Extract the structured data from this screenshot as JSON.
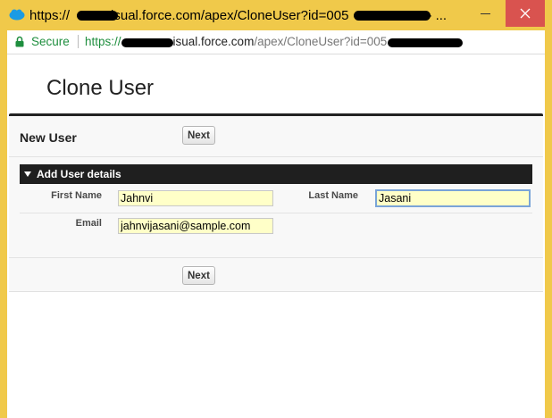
{
  "window": {
    "title": "https://",
    "title_tail": "isual.force.com/apex/CloneUser?id=005",
    "title_end": "- ..."
  },
  "address_bar": {
    "secure_label": "Secure",
    "url_scheme": "https://",
    "url_host": "isual.force.com",
    "url_path": "/apex/CloneUser?id=005"
  },
  "page": {
    "title": "Clone User"
  },
  "section": {
    "title": "New User",
    "next_label": "Next"
  },
  "user_details": {
    "header": "Add User details",
    "first_name_label": "First Name",
    "first_name_value": "Jahnvi",
    "last_name_label": "Last Name",
    "last_name_value": "Jasani",
    "email_label": "Email",
    "email_value": "jahnvijasani@sample.com"
  },
  "colors": {
    "title_bar": "#f0c94a",
    "secure_green": "#1e8e3e",
    "input_fill": "#ffffc8",
    "header_bar": "#1f1f1f"
  }
}
